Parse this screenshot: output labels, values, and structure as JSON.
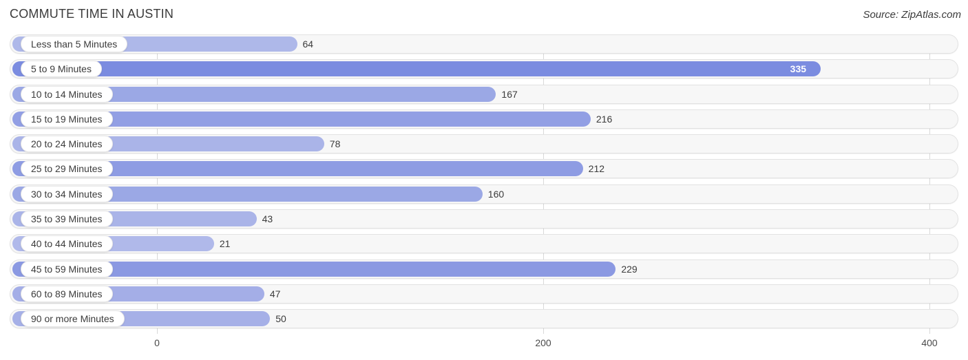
{
  "header": {
    "title": "COMMUTE TIME IN AUSTIN",
    "source": "Source: ZipAtlas.com"
  },
  "chart_data": {
    "type": "bar",
    "orientation": "horizontal",
    "title": "COMMUTE TIME IN AUSTIN",
    "subtitle": "",
    "xlabel": "",
    "ylabel": "",
    "xlim": [
      0,
      400
    ],
    "ticks": [
      "0",
      "200",
      "400"
    ],
    "tick_values": [
      0,
      200,
      400
    ],
    "grid": true,
    "legend": null,
    "categories": [
      "Less than 5 Minutes",
      "5 to 9 Minutes",
      "10 to 14 Minutes",
      "15 to 19 Minutes",
      "20 to 24 Minutes",
      "25 to 29 Minutes",
      "30 to 34 Minutes",
      "35 to 39 Minutes",
      "40 to 44 Minutes",
      "45 to 59 Minutes",
      "60 to 89 Minutes",
      "90 or more Minutes"
    ],
    "values": [
      64,
      335,
      167,
      216,
      78,
      212,
      160,
      43,
      21,
      229,
      47,
      50
    ],
    "value_labels": [
      "64",
      "335",
      "167",
      "216",
      "78",
      "212",
      "160",
      "43",
      "21",
      "229",
      "47",
      "50"
    ],
    "colors": {
      "bar_low": "#aab4e8",
      "bar_high": "#7b8ce0",
      "track": "#f7f7f7",
      "track_border": "#e2e2e2",
      "grid": "#d8d8d8",
      "text": "#3b3b3b",
      "value_inside_text": "#ffffff"
    },
    "bars": [
      {
        "label": "Less than 5 Minutes",
        "value": 64,
        "value_label": "64",
        "color": "#aeb8e9",
        "label_inside": false
      },
      {
        "label": "5 to 9 Minutes",
        "value": 335,
        "value_label": "335",
        "color": "#7b8ce0",
        "label_inside": true
      },
      {
        "label": "10 to 14 Minutes",
        "value": 167,
        "value_label": "167",
        "color": "#9ba8e5",
        "label_inside": false
      },
      {
        "label": "15 to 19 Minutes",
        "value": 216,
        "value_label": "216",
        "color": "#929fe4",
        "label_inside": false
      },
      {
        "label": "20 to 24 Minutes",
        "value": 78,
        "value_label": "78",
        "color": "#aab4e8",
        "label_inside": false
      },
      {
        "label": "25 to 29 Minutes",
        "value": 212,
        "value_label": "212",
        "color": "#8e9ce3",
        "label_inside": false
      },
      {
        "label": "30 to 34 Minutes",
        "value": 160,
        "value_label": "160",
        "color": "#9ba8e5",
        "label_inside": false
      },
      {
        "label": "35 to 39 Minutes",
        "value": 43,
        "value_label": "43",
        "color": "#aab4e8",
        "label_inside": false
      },
      {
        "label": "40 to 44 Minutes",
        "value": 21,
        "value_label": "21",
        "color": "#b0b9ea",
        "label_inside": false
      },
      {
        "label": "45 to 59 Minutes",
        "value": 229,
        "value_label": "229",
        "color": "#8b99e2",
        "label_inside": false
      },
      {
        "label": "60 to 89 Minutes",
        "value": 47,
        "value_label": "47",
        "color": "#a4aee7",
        "label_inside": false
      },
      {
        "label": "90 or more Minutes",
        "value": 50,
        "value_label": "50",
        "color": "#a6b0e7",
        "label_inside": false
      }
    ]
  }
}
